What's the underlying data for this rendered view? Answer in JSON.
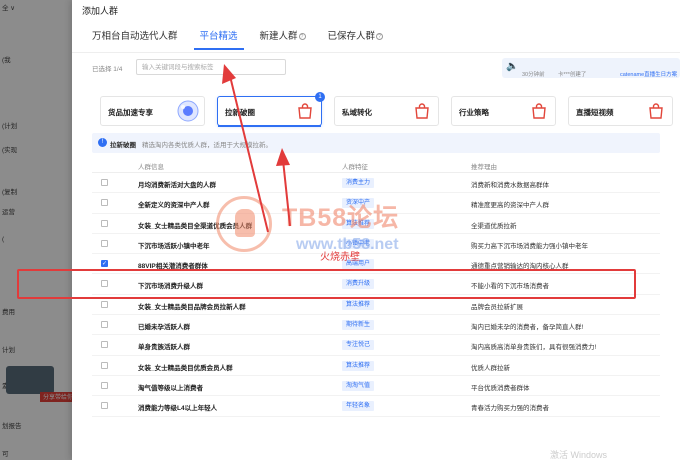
{
  "background": {
    "lines": [
      "全 ∨",
      "(我",
      "(计划",
      "(实现",
      "(复制",
      "运营",
      "(",
      "费用",
      "计划",
      "素",
      "划报告",
      "可"
    ],
    "red_tag": "分享带给你"
  },
  "modal": {
    "title": "添加人群",
    "tabs": [
      {
        "label": "万相台自动选代人群",
        "has_help": false
      },
      {
        "label": "平台精选",
        "has_help": false,
        "active": true
      },
      {
        "label": "新建人群",
        "has_help": true
      },
      {
        "label": "已保存人群",
        "has_help": true
      }
    ],
    "selected_label": "已选择 1/4",
    "search_placeholder": "输入关键词段与搜索标签",
    "notice": {
      "count_text": "30分钟前",
      "user_text": "卡***创建了",
      "link_text": "catename直播生日方案"
    },
    "categories": [
      {
        "label": "货品加速专享",
        "icon": "bubble-icon"
      },
      {
        "label": "拉新破圈",
        "icon": "bag-icon",
        "active": true,
        "badge": "1"
      },
      {
        "label": "私域转化",
        "icon": "bag-icon"
      },
      {
        "label": "行业策略",
        "icon": "bag-icon"
      },
      {
        "label": "直播短视频",
        "icon": "bag-icon"
      }
    ],
    "category_desc": {
      "name": "拉新破圈",
      "text": "精选淘内各类优质人群，适用于大规模拉新。"
    },
    "table": {
      "headers": [
        "人群信息",
        "人群特征",
        "推荐理由"
      ],
      "rows": [
        {
          "name": "月均消费新活对大盘的人群",
          "tag": "消费主力",
          "reason": "消费新和消费水数据高群体",
          "checked": false
        },
        {
          "name": "全新定义的资深中产人群",
          "tag": "资深中产",
          "reason": "精准度更高的资深中产人群",
          "checked": false
        },
        {
          "name": "女装_女士精品类目全渠道优质会员人群",
          "tag": "算法推荐",
          "reason": "全渠道优质拉新",
          "checked": false
        },
        {
          "name": "下沉市场活跃小镇中老年",
          "tag": "小镇中老",
          "reason": "购买力高下沉市场消费能力强小镇中老年",
          "checked": false
        },
        {
          "name": "88VIP相关潜消费者群体",
          "tag": "高端用户",
          "reason": "通德重点营销输达的淘内核心人群",
          "checked": true
        },
        {
          "name": "下沉市场消费升级人群",
          "tag": "消费升级",
          "reason": "不能小看的下沉市场消费者",
          "checked": false
        },
        {
          "name": "女装_女士精品类目品牌会员拉新人群",
          "tag": "算法推荐",
          "reason": "品牌会员拉新扩展",
          "checked": false
        },
        {
          "name": "已婚未孕活跃人群",
          "tag": "期待新生",
          "reason": "淘内已婚未孕的消费者，备孕简直人群!",
          "checked": false
        },
        {
          "name": "单身贵族活跃人群",
          "tag": "专注悦己",
          "reason": "淘内高质高消单身贵族们，具有很强消费力!",
          "checked": false
        },
        {
          "name": "女装_女士精品类目优质会员人群",
          "tag": "算法推荐",
          "reason": "优质人群拉新",
          "checked": false
        },
        {
          "name": "淘气值等级以上消费者",
          "tag": "淘淘气值",
          "reason": "平台优质消费者群体",
          "checked": false
        },
        {
          "name": "消费能力等级L4以上年轻人",
          "tag": "年轻名象",
          "reason": "青春活力购买力强的消费者",
          "checked": false
        }
      ]
    }
  },
  "watermark": {
    "brand": "TB58论坛",
    "url": "www.tb58.net",
    "annotation": "火烧赤壁"
  },
  "bottom_hint": "激活 Windows",
  "colors": {
    "accent": "#2f6ff3",
    "highlight": "#e23b3b",
    "tag_bg": "#e9f0fe"
  }
}
